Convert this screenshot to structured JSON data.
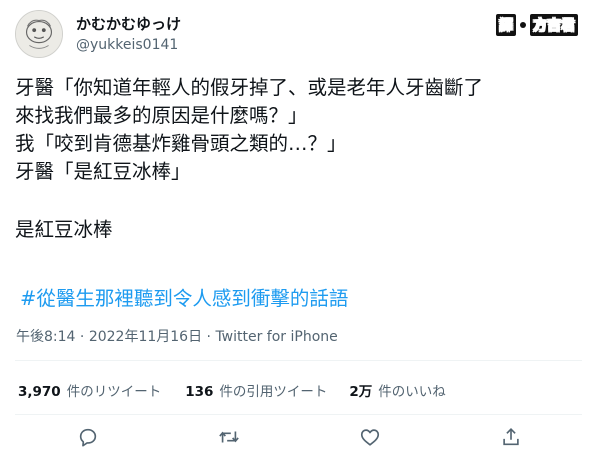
{
  "user": {
    "display_name": "かむかむゆっけ",
    "handle": "@yukkeis0141"
  },
  "credit": {
    "label": "譯",
    "name": "方吉君"
  },
  "tweet": {
    "lines": [
      "牙醫「你知道年輕人的假牙掉了、或是老年人牙齒斷了",
      "來找我們最多的原因是什麼嗎？」",
      "我「咬到肯德基炸雞骨頭之類的…？」",
      "牙醫「是紅豆冰棒」",
      "",
      "是紅豆冰棒"
    ],
    "hashtag": "#從醫生那裡聽到令人感到衝擊的話語"
  },
  "meta": {
    "time": "午後8:14",
    "separator": "·",
    "date": "2022年11月16日",
    "source": "Twitter for iPhone"
  },
  "stats": {
    "retweets": {
      "count": "3,970",
      "label": "件のリツイート"
    },
    "quotes": {
      "count": "136",
      "label": "件の引用ツイート"
    },
    "likes": {
      "count": "2万",
      "label": "件のいいね"
    }
  },
  "icons": {
    "reply": "reply-icon",
    "retweet": "retweet-icon",
    "like": "heart-icon",
    "share": "share-icon"
  },
  "colors": {
    "text": "#0f1419",
    "secondary": "#536471",
    "link": "#1d9bf0",
    "divider": "#eff3f4"
  }
}
